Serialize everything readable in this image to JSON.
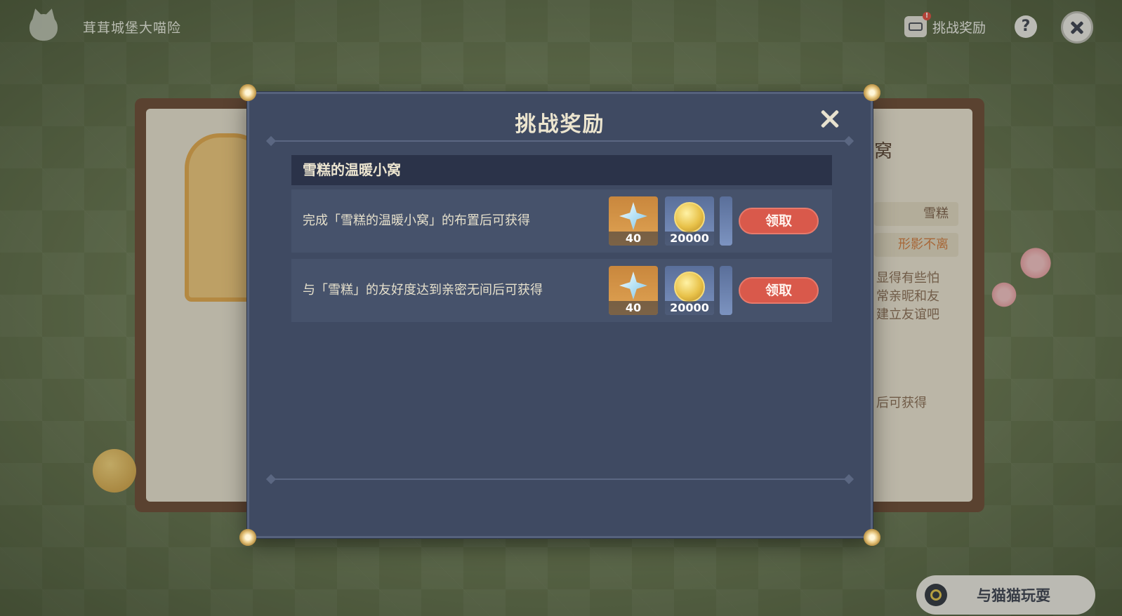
{
  "event": {
    "title": "茸茸城堡大喵险",
    "reward_link_label": "挑战奖励",
    "notify_badge": "!",
    "help_label": "?"
  },
  "background": {
    "right_title": "窝",
    "right_name": "雪糕",
    "right_trait": "形影不离",
    "right_desc": [
      "显得有些怕",
      "常亲昵和友",
      "建立友谊吧"
    ],
    "right_footer": "后可获得",
    "play_button_label": "与猫猫玩耍"
  },
  "modal": {
    "title": "挑战奖励",
    "section_title": "雪糕的温暖小窝",
    "tasks": [
      {
        "text": "完成「雪糕的温暖小窝」的布置后可获得",
        "rewards": [
          {
            "icon": "primogem-icon",
            "qty": "40"
          },
          {
            "icon": "mora-coin-icon",
            "qty": "20000"
          },
          {
            "icon": "reward-item-partial",
            "qty": ""
          }
        ],
        "button_label": "领取"
      },
      {
        "text": "与「雪糕」的友好度达到亲密无间后可获得",
        "rewards": [
          {
            "icon": "primogem-icon",
            "qty": "40"
          },
          {
            "icon": "mora-coin-icon",
            "qty": "20000"
          },
          {
            "icon": "reward-item-partial",
            "qty": ""
          }
        ],
        "button_label": "领取"
      }
    ]
  },
  "colors": {
    "modal_bg": "#3f4a62",
    "claim_button": "#d9594b",
    "title_text": "#ece5cf"
  }
}
